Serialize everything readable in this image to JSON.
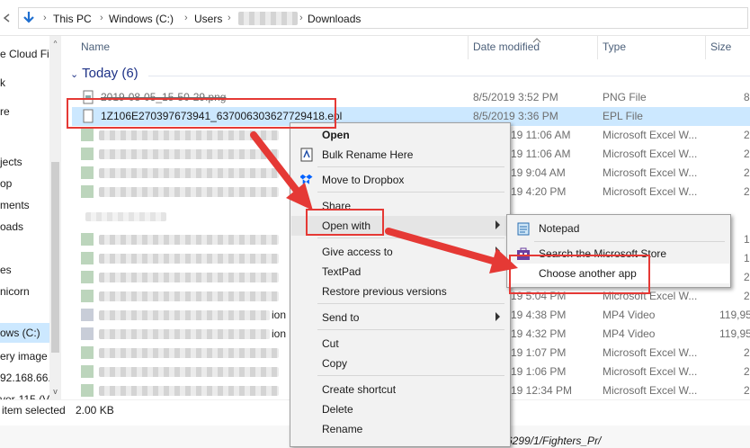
{
  "address_bar": {
    "crumbs": [
      "This PC",
      "Windows (C:)",
      "Users",
      "Downloads"
    ]
  },
  "sidebar": {
    "items": [
      {
        "label": "e Cloud Fil",
        "selected": false
      },
      {
        "label": "k",
        "selected": false
      },
      {
        "label": "re",
        "selected": false
      },
      {
        "label": "jects",
        "selected": false
      },
      {
        "label": "op",
        "selected": false
      },
      {
        "label": "ments",
        "selected": false
      },
      {
        "label": "oads",
        "selected": false
      },
      {
        "label": "es",
        "selected": false
      },
      {
        "label": "nicorn",
        "selected": false
      },
      {
        "label": "ows (C:)",
        "selected": true
      },
      {
        "label": "ery image",
        "selected": false
      },
      {
        "label": "92.168.66.",
        "selected": false
      },
      {
        "label": "ver-115 (V",
        "selected": false
      }
    ]
  },
  "columns": {
    "name": "Name",
    "date": "Date modified",
    "type": "Type",
    "size": "Size"
  },
  "group": {
    "label": "Today (6)"
  },
  "rows": [
    {
      "name": "2019-08-05_15-50-29.png",
      "date": "8/5/2019 3:52 PM",
      "type": "PNG File",
      "size": "8",
      "selected": false
    },
    {
      "name": "1Z106E270397673941_637006303627729418.epl",
      "date": "8/5/2019 3:36 PM",
      "type": "EPL File",
      "size": "",
      "selected": true
    },
    {
      "name": "",
      "date": "19 11:06 AM",
      "type": "Microsoft Excel W...",
      "size": "2"
    },
    {
      "name": "",
      "date": "19 11:06 AM",
      "type": "Microsoft Excel W...",
      "size": "2"
    },
    {
      "name": "",
      "date": "19 9:04 AM",
      "type": "Microsoft Excel W...",
      "size": "2"
    },
    {
      "name": "",
      "date": "19 4:20 PM",
      "type": "Microsoft Excel W...",
      "size": "2"
    },
    {
      "name": "",
      "date": "19 5:04 PM",
      "type": "Microsoft Excel W...",
      "size": "2"
    },
    {
      "name": "ion",
      "date": "19 4:38 PM",
      "type": "MP4 Video",
      "size": "119,95"
    },
    {
      "name": "ion",
      "date": "19 4:32 PM",
      "type": "MP4 Video",
      "size": "119,95"
    },
    {
      "name": "",
      "date": "19 1:07 PM",
      "type": "Microsoft Excel W...",
      "size": "2"
    },
    {
      "name": "",
      "date": "19 1:06 PM",
      "type": "Microsoft Excel W...",
      "size": "2"
    },
    {
      "name": "",
      "date": "19 12:34 PM",
      "type": "Microsoft Excel W...",
      "size": "2"
    }
  ],
  "right_partial": [
    "1",
    "1",
    "2"
  ],
  "context_menu": {
    "open": "Open",
    "bulk_rename": "Bulk Rename Here",
    "dropbox": "Move to Dropbox",
    "share": "Share",
    "open_with": "Open with",
    "give_access": "Give access to",
    "textpad": "TextPad",
    "restore": "Restore previous versions",
    "send_to": "Send to",
    "cut": "Cut",
    "copy": "Copy",
    "create_shortcut": "Create shortcut",
    "delete": "Delete",
    "rename": "Rename"
  },
  "submenu": {
    "notepad": "Notepad",
    "store": "Search the Microsoft Store",
    "choose": "Choose another app"
  },
  "status": {
    "selection": "item selected",
    "size": "2.00 KB",
    "path_fragment": "6299/1/Fighters_Pr/"
  },
  "colors": {
    "selection": "#cce8ff",
    "annotation": "#e53935",
    "group_header": "#1e3287"
  }
}
